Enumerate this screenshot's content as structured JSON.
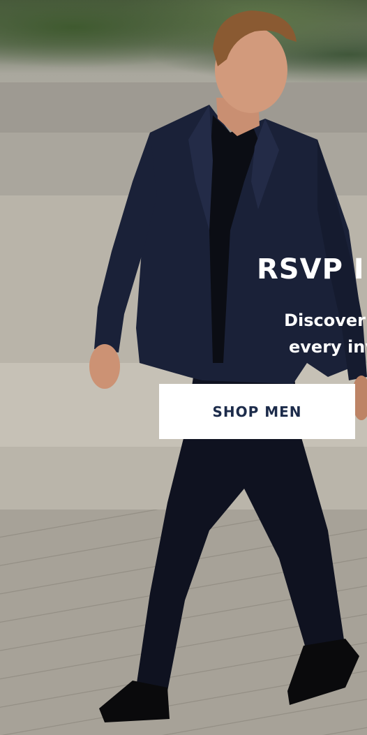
{
  "hero": {
    "headline": "RSVP I",
    "subtext_line1": "Discover dress s",
    "subtext_line2": "every invite wo",
    "cta_label": "SHOP MEN"
  },
  "colors": {
    "cta_background": "#ffffff",
    "cta_text": "#1c2b4a",
    "headline_text": "#ffffff"
  }
}
